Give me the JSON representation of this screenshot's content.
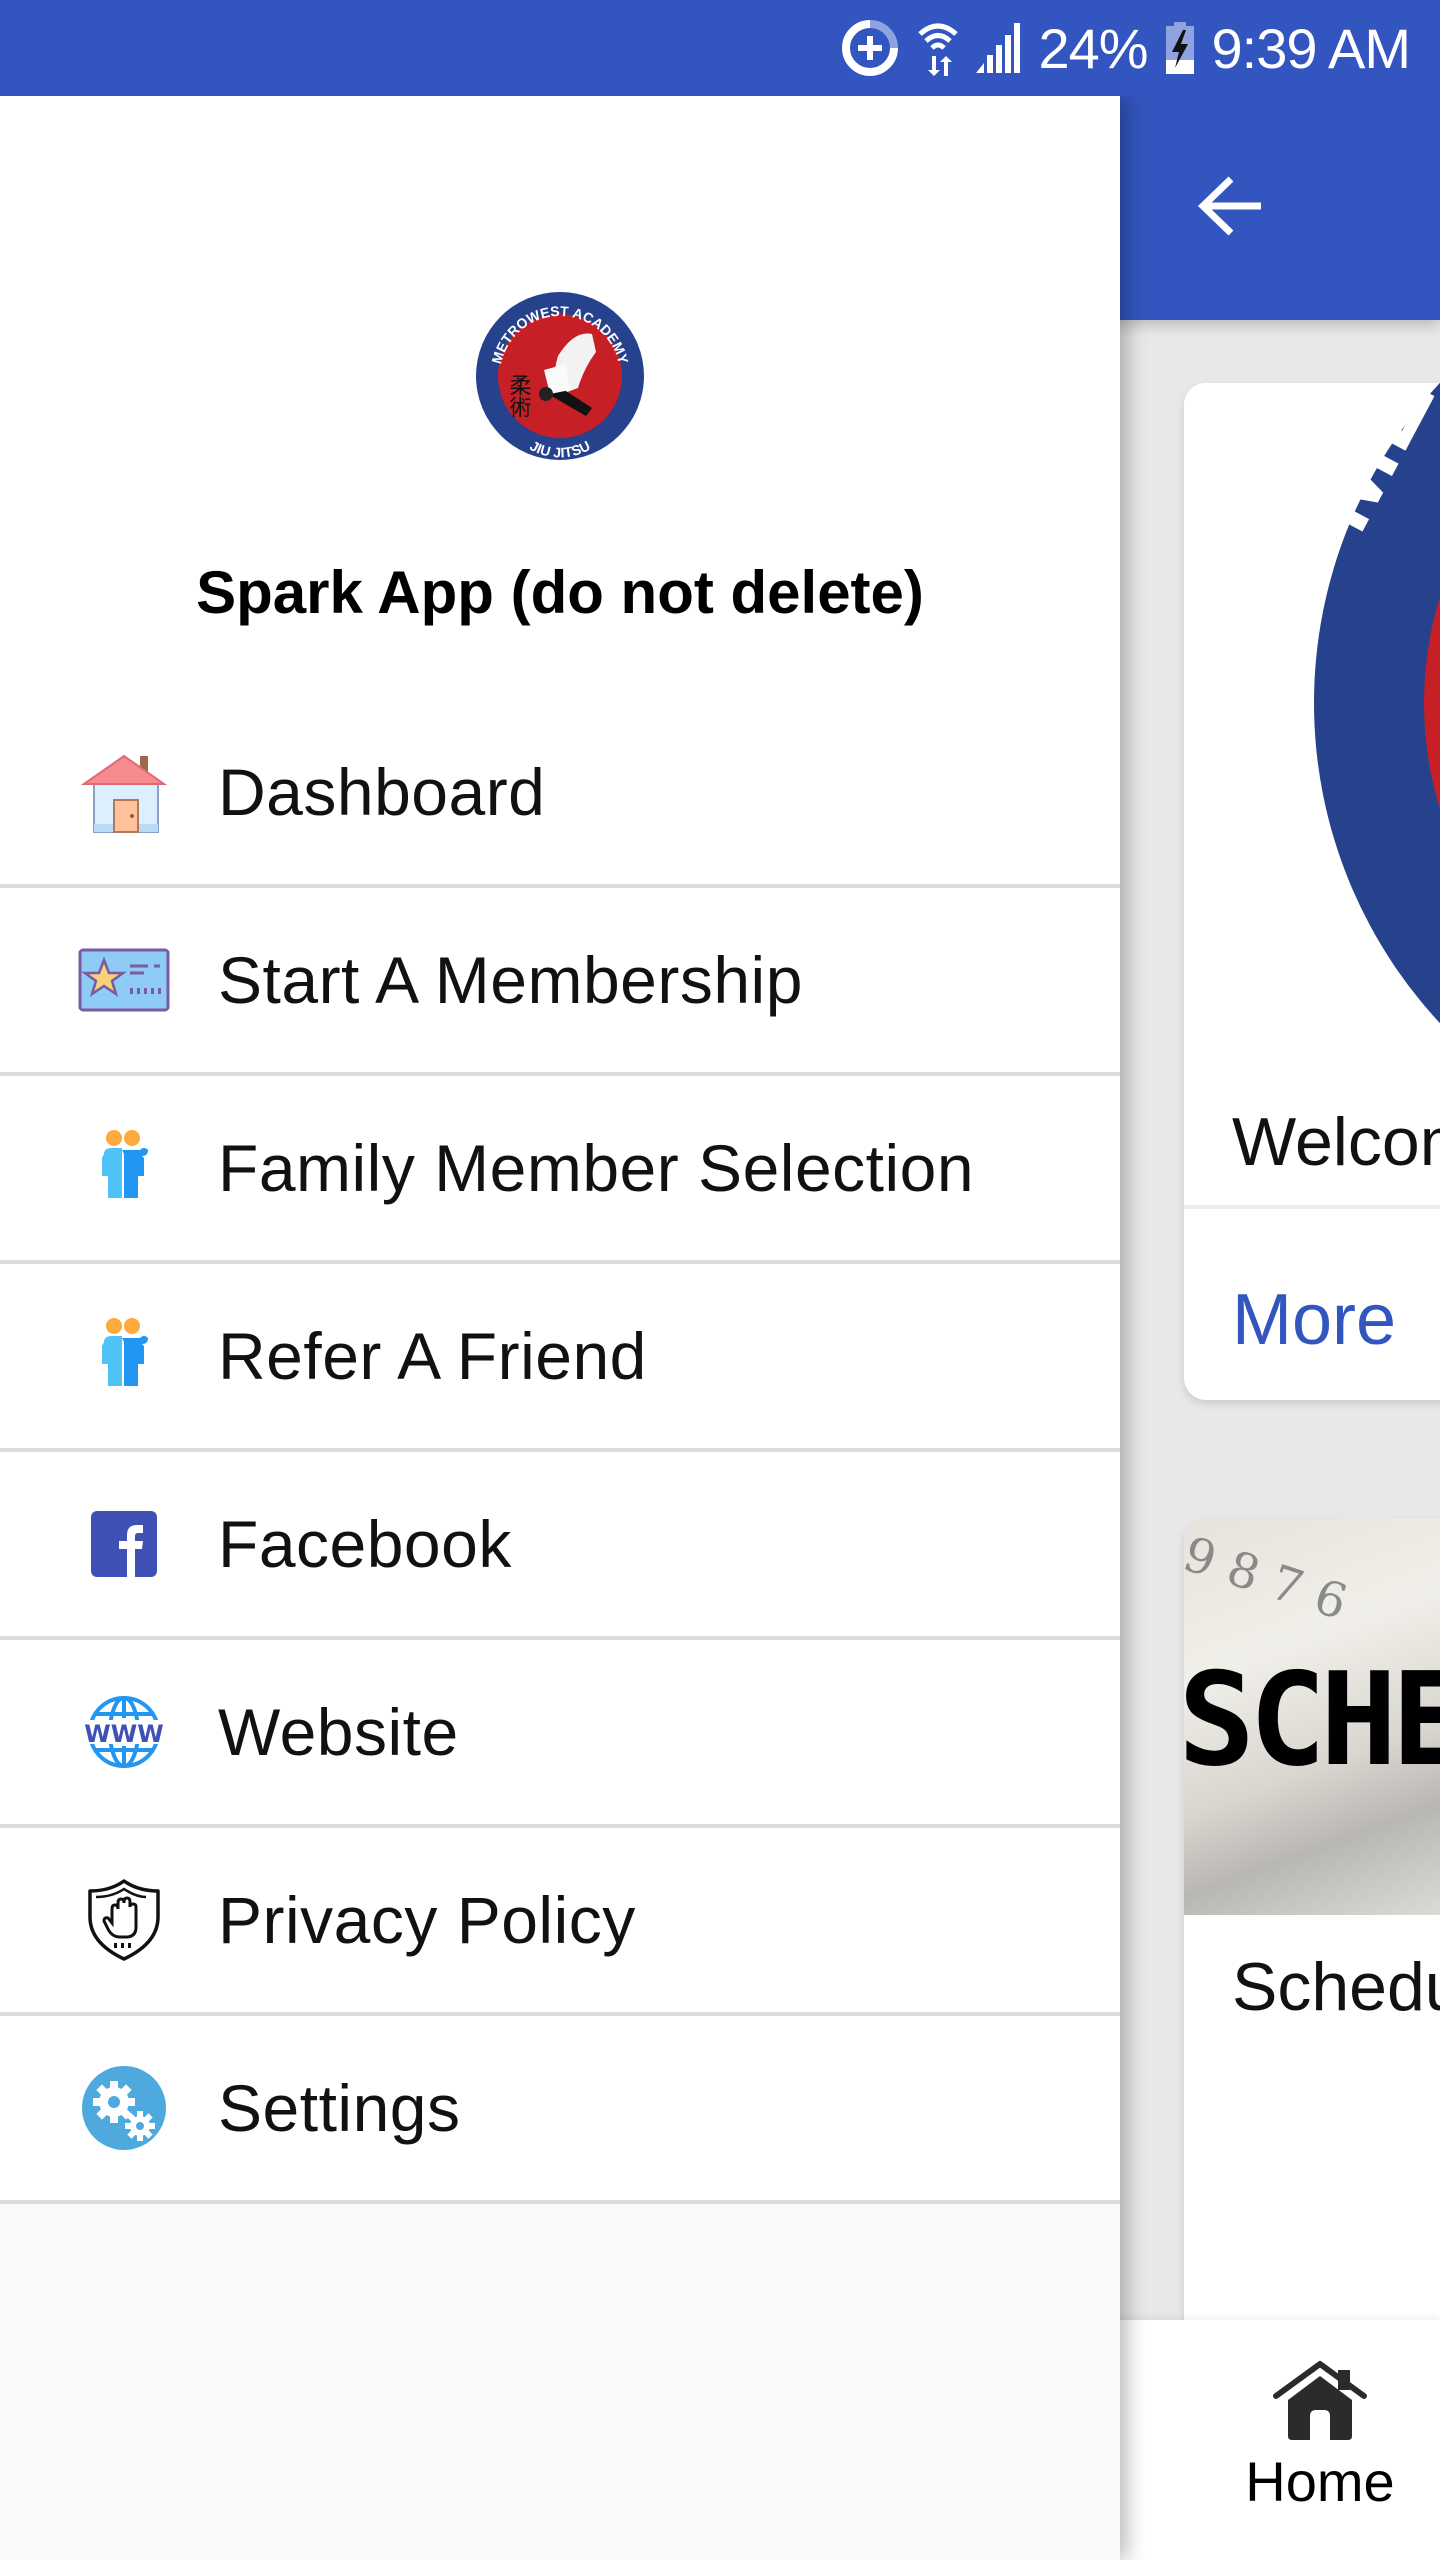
{
  "status_bar": {
    "battery_percent": "24%",
    "time": "9:39 AM",
    "icons": [
      "data-saver-icon",
      "wifi-icon",
      "signal-icon",
      "battery-charging-icon"
    ]
  },
  "app_bar": {
    "back_icon": "arrow-left-icon"
  },
  "drawer": {
    "logo": {
      "top_text": "METROWEST ACADEMY",
      "bottom_text": "JIU JITSU",
      "kanji": "柔術"
    },
    "title": "Spark App (do not delete)",
    "items": [
      {
        "label": "Dashboard",
        "icon": "house-icon"
      },
      {
        "label": "Start A Membership",
        "icon": "membership-card-icon"
      },
      {
        "label": "Family Member Selection",
        "icon": "friends-icon"
      },
      {
        "label": "Refer A Friend",
        "icon": "friends-icon"
      },
      {
        "label": "Facebook",
        "icon": "facebook-icon"
      },
      {
        "label": "Website",
        "icon": "www-globe-icon"
      },
      {
        "label": "Privacy Policy",
        "icon": "shield-hand-icon"
      },
      {
        "label": "Settings",
        "icon": "gears-icon"
      }
    ]
  },
  "content": {
    "cards": [
      {
        "title": "Welcome",
        "action": "More",
        "image": "metrowest-academy-logo"
      },
      {
        "title": "Schedule",
        "image_text": "SCHEDULE",
        "image_clock_numbers": "9 8 7 6"
      }
    ]
  },
  "bottom_nav": {
    "items": [
      {
        "label": "Home",
        "icon": "home-icon"
      }
    ]
  },
  "colors": {
    "primary": "#3355bf",
    "divider": "#dcdcdc",
    "drawer_footer_bg": "#f9f9f9",
    "content_bg": "#e8e8e8"
  }
}
